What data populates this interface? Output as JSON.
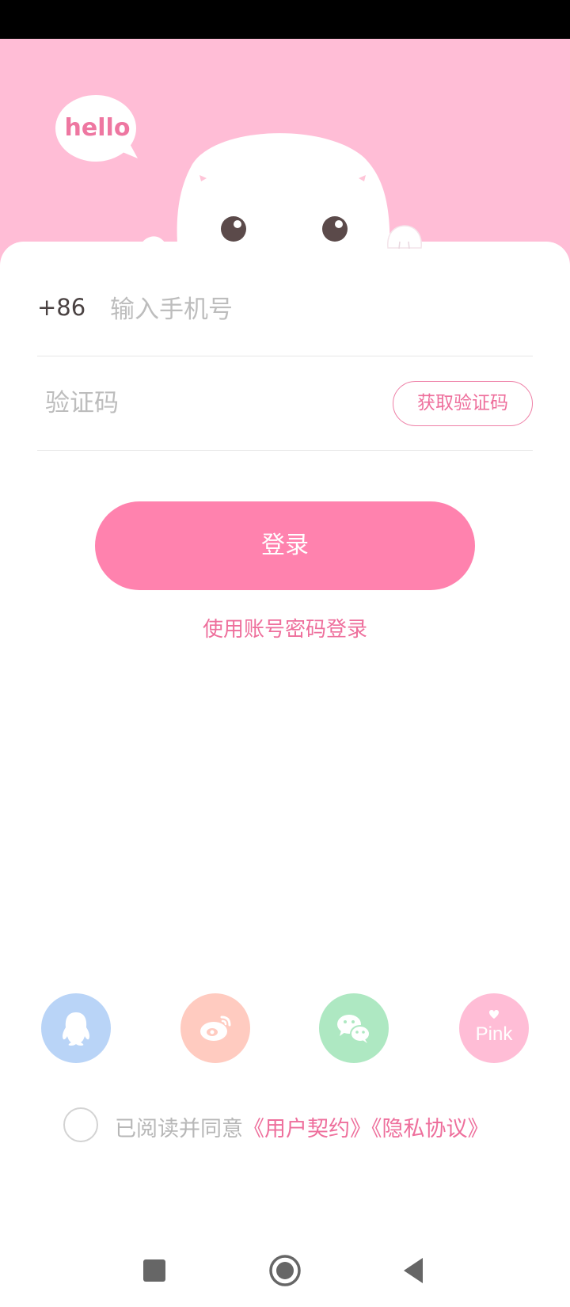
{
  "header": {
    "bubble_text": "hello"
  },
  "login_form": {
    "country_code": "+86",
    "phone_placeholder": "输入手机号",
    "code_placeholder": "验证码",
    "get_code_label": "获取验证码",
    "login_label": "登录",
    "account_login_link": "使用账号密码登录"
  },
  "social_login": {
    "items": [
      {
        "icon": "qq-icon",
        "color": "#b9d4f7"
      },
      {
        "icon": "weibo-icon",
        "color": "#ffcbc0"
      },
      {
        "icon": "wechat-icon",
        "color": "#aee8c2"
      },
      {
        "icon": "pink-logo-icon",
        "color": "#ffbdd6",
        "label": "Pink"
      }
    ]
  },
  "agreement": {
    "prefix": "已阅读并同意",
    "user_agreement": "《用户契约》",
    "privacy_policy": "《隐私协议》",
    "checked": false
  },
  "colors": {
    "header_bg": "#ffbdd6",
    "accent": "#ff82ae",
    "link": "#ee6f9c"
  },
  "nav_bar": {
    "items": [
      "square-icon",
      "home-circle-icon",
      "back-triangle-icon"
    ]
  }
}
